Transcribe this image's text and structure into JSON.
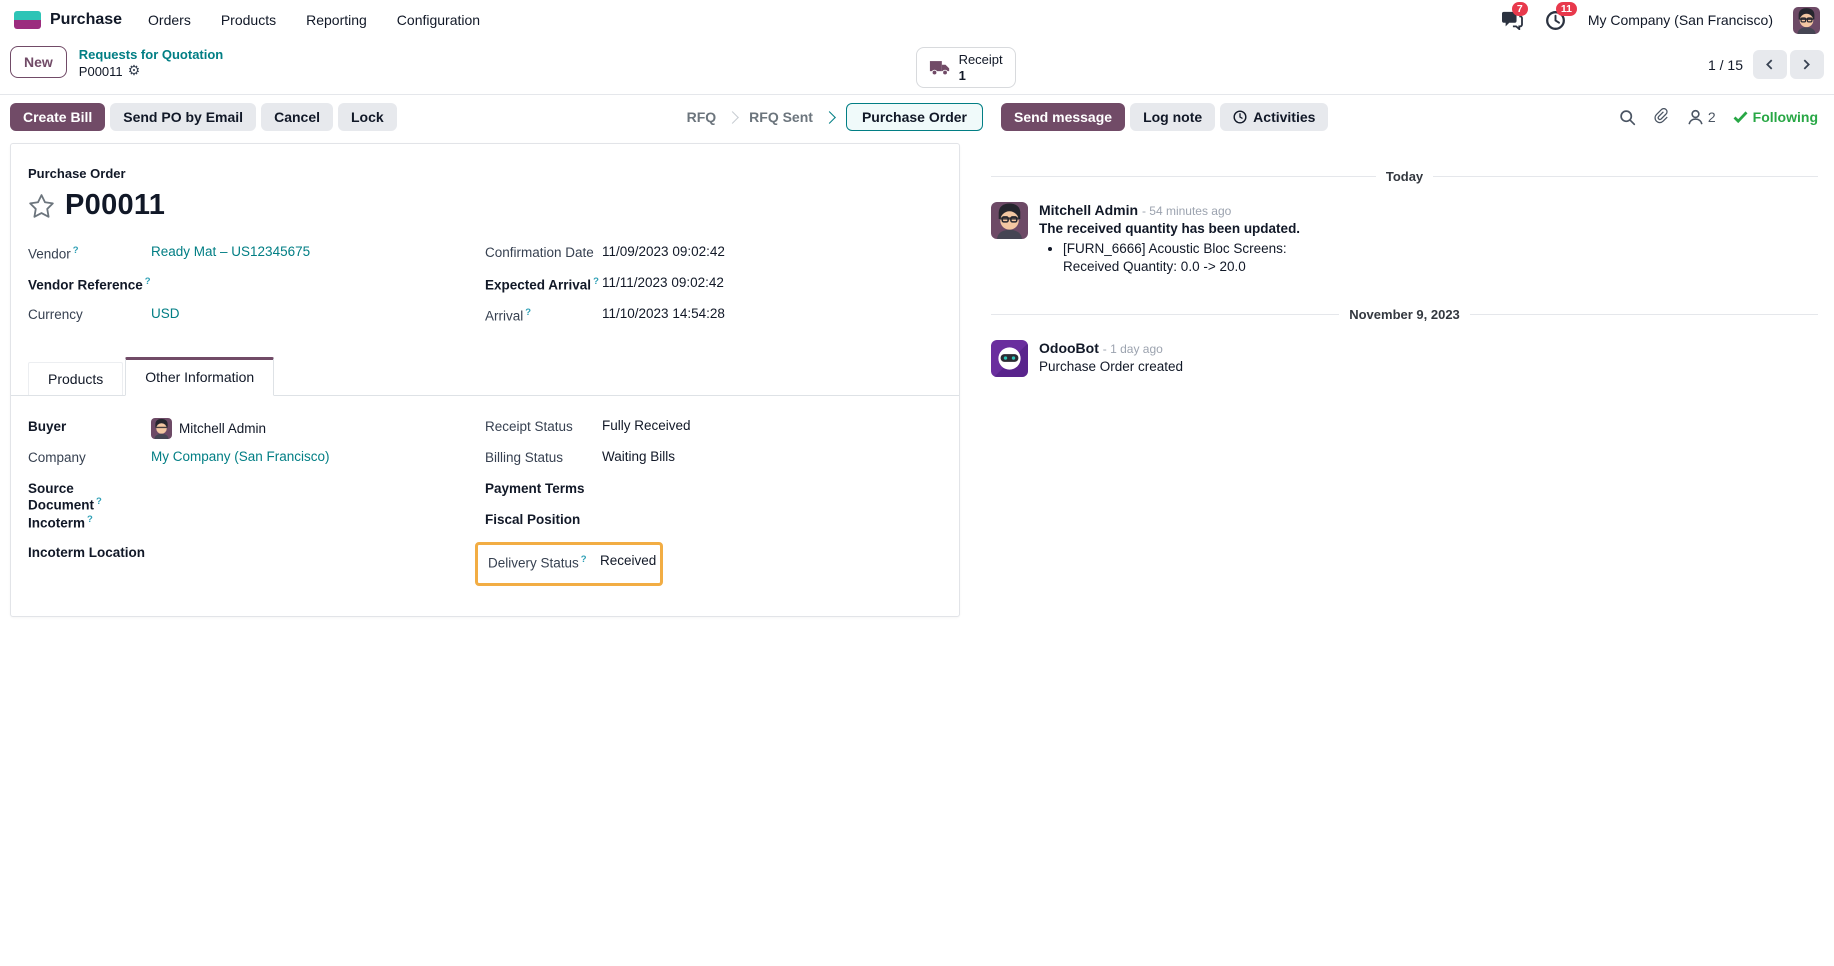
{
  "nav": {
    "app_name": "Purchase",
    "menus": [
      "Orders",
      "Products",
      "Reporting",
      "Configuration"
    ],
    "messages_badge": "7",
    "activities_badge": "11",
    "company": "My Company (San Francisco)"
  },
  "breadcrumb": {
    "new_button": "New",
    "parent": "Requests for Quotation",
    "current": "P00011"
  },
  "smart_button": {
    "label": "Receipt",
    "count": "1"
  },
  "pager": {
    "value": "1 / 15"
  },
  "actions": {
    "create_bill": "Create Bill",
    "send_po_by_email": "Send PO by Email",
    "cancel": "Cancel",
    "lock": "Lock"
  },
  "statusbar": {
    "steps": [
      "RFQ",
      "RFQ Sent",
      "Purchase Order"
    ],
    "active_step": "Purchase Order"
  },
  "form": {
    "doc_type": "Purchase Order",
    "title": "P00011",
    "fields": {
      "vendor": {
        "label": "Vendor",
        "value": "Ready Mat – US12345675"
      },
      "vendor_reference": {
        "label": "Vendor Reference",
        "value": ""
      },
      "currency": {
        "label": "Currency",
        "value": "USD"
      },
      "confirmation_date": {
        "label": "Confirmation Date",
        "value": "11/09/2023 09:02:42"
      },
      "expected_arrival": {
        "label": "Expected Arrival",
        "value": "11/11/2023 09:02:42"
      },
      "arrival": {
        "label": "Arrival",
        "value": "11/10/2023 14:54:28"
      },
      "buyer": {
        "label": "Buyer",
        "value": "Mitchell Admin"
      },
      "company": {
        "label": "Company",
        "value": "My Company (San Francisco)"
      },
      "source_document": {
        "label": "Source Document",
        "value": ""
      },
      "incoterm": {
        "label": "Incoterm",
        "value": ""
      },
      "incoterm_location": {
        "label": "Incoterm Location",
        "value": ""
      },
      "receipt_status": {
        "label": "Receipt Status",
        "value": "Fully Received"
      },
      "billing_status": {
        "label": "Billing Status",
        "value": "Waiting Bills"
      },
      "payment_terms": {
        "label": "Payment Terms",
        "value": ""
      },
      "fiscal_position": {
        "label": "Fiscal Position",
        "value": ""
      },
      "delivery_status": {
        "label": "Delivery Status",
        "value": "Received"
      }
    },
    "tabs": [
      "Products",
      "Other Information"
    ],
    "active_tab": "Other Information"
  },
  "chatter": {
    "send_message": "Send message",
    "log_note": "Log note",
    "activities": "Activities",
    "followers_count": "2",
    "following": "Following",
    "dividers": [
      "Today",
      "November 9, 2023"
    ],
    "messages": [
      {
        "author": "Mitchell Admin",
        "time": "- 54 minutes ago",
        "title": "The received quantity has been updated.",
        "bullet_line1": "[FURN_6666] Acoustic Bloc Screens:",
        "bullet_line2": "Received Quantity: 0.0 -> 20.0"
      },
      {
        "author": "OdooBot",
        "time": "- 1 day ago",
        "body": "Purchase Order created"
      }
    ]
  },
  "ui": {
    "help_marker": "?"
  },
  "colors": {
    "primary": "#714B67",
    "link_teal": "#017E84",
    "status_active_border": "#017E84",
    "highlight_orange": "#F2AD44",
    "badge_red": "#E8394C",
    "following_green": "#28a745"
  }
}
